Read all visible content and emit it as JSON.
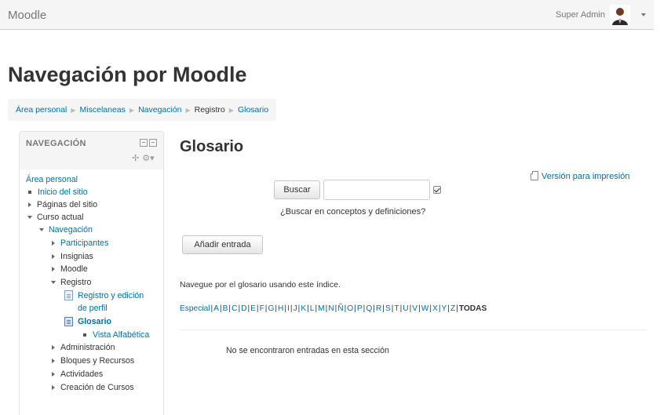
{
  "navbar": {
    "brand": "Moodle",
    "user_name": "Super Admin"
  },
  "page_title": "Navegación por Moodle",
  "breadcrumb": [
    {
      "label": "Área personal",
      "link": true
    },
    {
      "label": "Miscelaneas",
      "link": true
    },
    {
      "label": "Navegación",
      "link": true
    },
    {
      "label": "Registro",
      "link": false
    },
    {
      "label": "Glosario",
      "link": true
    }
  ],
  "nav_block": {
    "title": "NAVEGACIÓN",
    "items": {
      "area_personal": "Área personal",
      "inicio": "Inicio del sitio",
      "paginas": "Páginas del sitio",
      "curso_actual": "Curso actual",
      "navegacion": "Navegación",
      "participantes": "Participantes",
      "insignias": "Insignias",
      "moodle": "Moodle",
      "registro": "Registro",
      "registro_edicion_1": "Registro y edición",
      "registro_edicion_2": "de perfil",
      "glosario": "Glosario",
      "vista_alfabetica": "Vista Alfabética",
      "administracion": "Administración",
      "bloques": "Bloques y Recursos",
      "actividades": "Actividades",
      "creacion": "Creación de Cursos"
    }
  },
  "main": {
    "title": "Glosario",
    "print_link": "Versión para impresión",
    "search_button": "Buscar",
    "search_value": "",
    "search_hint": "¿Buscar en conceptos y definiciones?",
    "add_button": "Añadir entrada",
    "browse_text": "Navegue por el glosario usando este índice.",
    "alphabet": [
      "Especial",
      "A",
      "B",
      "C",
      "D",
      "E",
      "F",
      "G",
      "H",
      "I",
      "J",
      "K",
      "L",
      "M",
      "N",
      "Ñ",
      "O",
      "P",
      "Q",
      "R",
      "S",
      "T",
      "U",
      "V",
      "W",
      "X",
      "Y",
      "Z"
    ],
    "all_label": "TODAS",
    "no_entries": "No se encontraron entradas en esta sección"
  },
  "colors": {
    "link": "#0070a8",
    "navbar_bg": "#f5f5f5"
  }
}
